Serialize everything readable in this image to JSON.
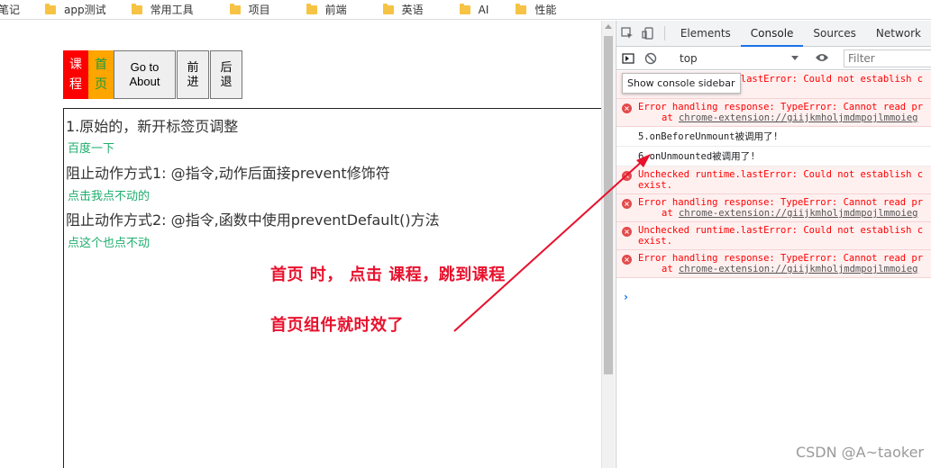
{
  "bookmarks": [
    {
      "label": "笔记",
      "icon": "folder-icon"
    },
    {
      "label": "app测试",
      "icon": "folder-icon"
    },
    {
      "label": "常用工具",
      "icon": "folder-icon"
    },
    {
      "label": "项目",
      "icon": "folder-icon"
    },
    {
      "label": "前端",
      "icon": "folder-icon"
    },
    {
      "label": "英语",
      "icon": "folder-icon"
    },
    {
      "label": "AI",
      "icon": "folder-icon"
    },
    {
      "label": "性能",
      "icon": "folder-icon"
    }
  ],
  "page": {
    "nav": {
      "course_link": "课程",
      "home_link": "首页",
      "go_about": "Go to About",
      "forward": "前进",
      "back": "后退"
    },
    "lines": [
      {
        "kind": "title",
        "text": "1.原始的，新开标签页调整"
      },
      {
        "kind": "link",
        "text": "百度一下"
      },
      {
        "kind": "title",
        "text": "阻止动作方式1: @指令,动作后面接prevent修饰符"
      },
      {
        "kind": "link",
        "text": "点击我点不动的"
      },
      {
        "kind": "title",
        "text": "阻止动作方式2: @指令,函数中使用preventDefault()方法"
      },
      {
        "kind": "link",
        "text": "点这个也点不动"
      }
    ],
    "annotation": {
      "line1": "首页 时， 点击 课程，跳到课程",
      "line2": "首页组件就时效了"
    }
  },
  "devtools": {
    "tabs": [
      "Elements",
      "Console",
      "Sources",
      "Network"
    ],
    "active_tab": "Console",
    "context": "top",
    "filter_placeholder": "Filter",
    "tooltip": "Show console sidebar",
    "messages": [
      {
        "level": "error",
        "text": "Unchecked runtime.lastError: Could not establish c",
        "cont": "exist."
      },
      {
        "level": "error",
        "text": "Error handling response: TypeError: Cannot read pr",
        "at": "at ",
        "link": "chrome-extension://giijkmholjmdmpojlmmoieg"
      },
      {
        "level": "info",
        "text": "5.onBeforeUnmount被调用了!"
      },
      {
        "level": "info",
        "text": "6.onUnmounted被调用了!"
      },
      {
        "level": "error",
        "text": "Unchecked runtime.lastError: Could not establish c",
        "cont": "exist."
      },
      {
        "level": "error",
        "text": "Error handling response: TypeError: Cannot read pr",
        "at": "at ",
        "link": "chrome-extension://giijkmholjmdmpojlmmoieg"
      },
      {
        "level": "error",
        "text": "Unchecked runtime.lastError: Could not establish c",
        "cont": "exist."
      },
      {
        "level": "error",
        "text": "Error handling response: TypeError: Cannot read pr",
        "at": "at ",
        "link": "chrome-extension://giijkmholjmdmpojlmmoieg"
      }
    ],
    "prompt": "›"
  },
  "watermark": "CSDN @A~taoker",
  "colors": {
    "annotation": "#e8112d",
    "link_green": "#1fae6d",
    "nav_red": "#ff0000",
    "nav_orange": "#ffa500",
    "devtools_active": "#1a73e8",
    "console_error": "#ff0000"
  }
}
